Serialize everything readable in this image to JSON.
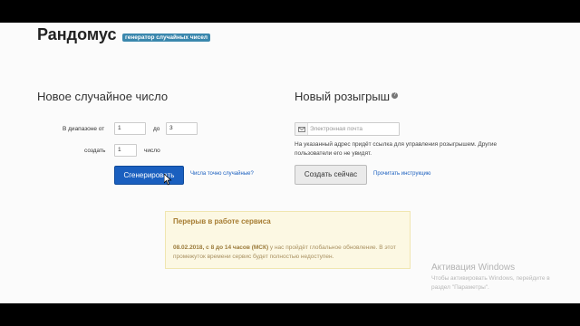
{
  "header": {
    "logo": "Рандомус",
    "badge": "генератор случайных чисел"
  },
  "random_number": {
    "title": "Новое случайное число",
    "range_label": "В диапазоне от",
    "from_value": "1",
    "to_label": "до",
    "to_value": "3",
    "create_label": "создать",
    "count_value": "1",
    "count_unit": "число",
    "generate_button": "Сгенерировать",
    "is_random_link": "Числа точно случайные?"
  },
  "giveaway": {
    "title": "Новый розыгрыш",
    "help_icon": "?",
    "email_placeholder": "Электронная почта",
    "note": "На указанный адрес придёт ссылка для управления розыгрышем. Другие пользователи его не увидят.",
    "create_button": "Создать сейчас",
    "instructions_link": "Прочитать инструкцию"
  },
  "alert": {
    "title": "Перерыв в работе сервиса",
    "date_bold": "08.02.2018, с 8 до 14 часов (МСК)",
    "body": " у нас пройдёт глобальное обновление. В этот промежуток времени сервис будет полностью недоступен."
  },
  "windows_watermark": {
    "title": "Активация Windows",
    "text": "Чтобы активировать Windows, перейдите в раздел \"Параметры\"."
  },
  "colors": {
    "primary": "#1a5fbf",
    "badge": "#3a87ad",
    "alert_bg": "#fcf8e3"
  }
}
